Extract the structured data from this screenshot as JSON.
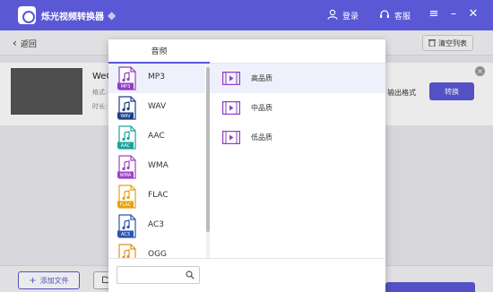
{
  "app": {
    "title": "烁光视频转换器"
  },
  "titlebar": {
    "login_label": "登录",
    "service_label": "客服"
  },
  "subbar": {
    "back_label": "返回",
    "clear_label": "清空列表"
  },
  "file": {
    "name": "WeC",
    "format_prefix": "格式:",
    "duration_prefix": "时长:",
    "output_format_label": "输出格式",
    "convert_label": "转换"
  },
  "bottombar": {
    "add_file_label": "添加文件"
  },
  "popup": {
    "tab_label": "音频",
    "formats": [
      {
        "label": "MP3",
        "badge": "MP3",
        "color": "#8e3fc4",
        "selected": true
      },
      {
        "label": "WAV",
        "badge": "WAV",
        "color": "#1d3f8a",
        "selected": false
      },
      {
        "label": "AAC",
        "badge": "AAC",
        "color": "#1aa39c",
        "selected": false
      },
      {
        "label": "WMA",
        "badge": "WMA",
        "color": "#9b43c9",
        "selected": false
      },
      {
        "label": "FLAC",
        "badge": "FLAC",
        "color": "#e5a20f",
        "selected": false
      },
      {
        "label": "AC3",
        "badge": "AC3",
        "color": "#2a55b3",
        "selected": false
      },
      {
        "label": "OGG",
        "badge": "OGG",
        "color": "#e0951a",
        "selected": false
      }
    ],
    "qualities": [
      {
        "label": "高品质",
        "selected": true
      },
      {
        "label": "中品质",
        "selected": false
      },
      {
        "label": "低品质",
        "selected": false
      }
    ],
    "search_placeholder": ""
  },
  "colors": {
    "accent": "#5b58d6",
    "quality_icon": "#8e3fc4"
  }
}
